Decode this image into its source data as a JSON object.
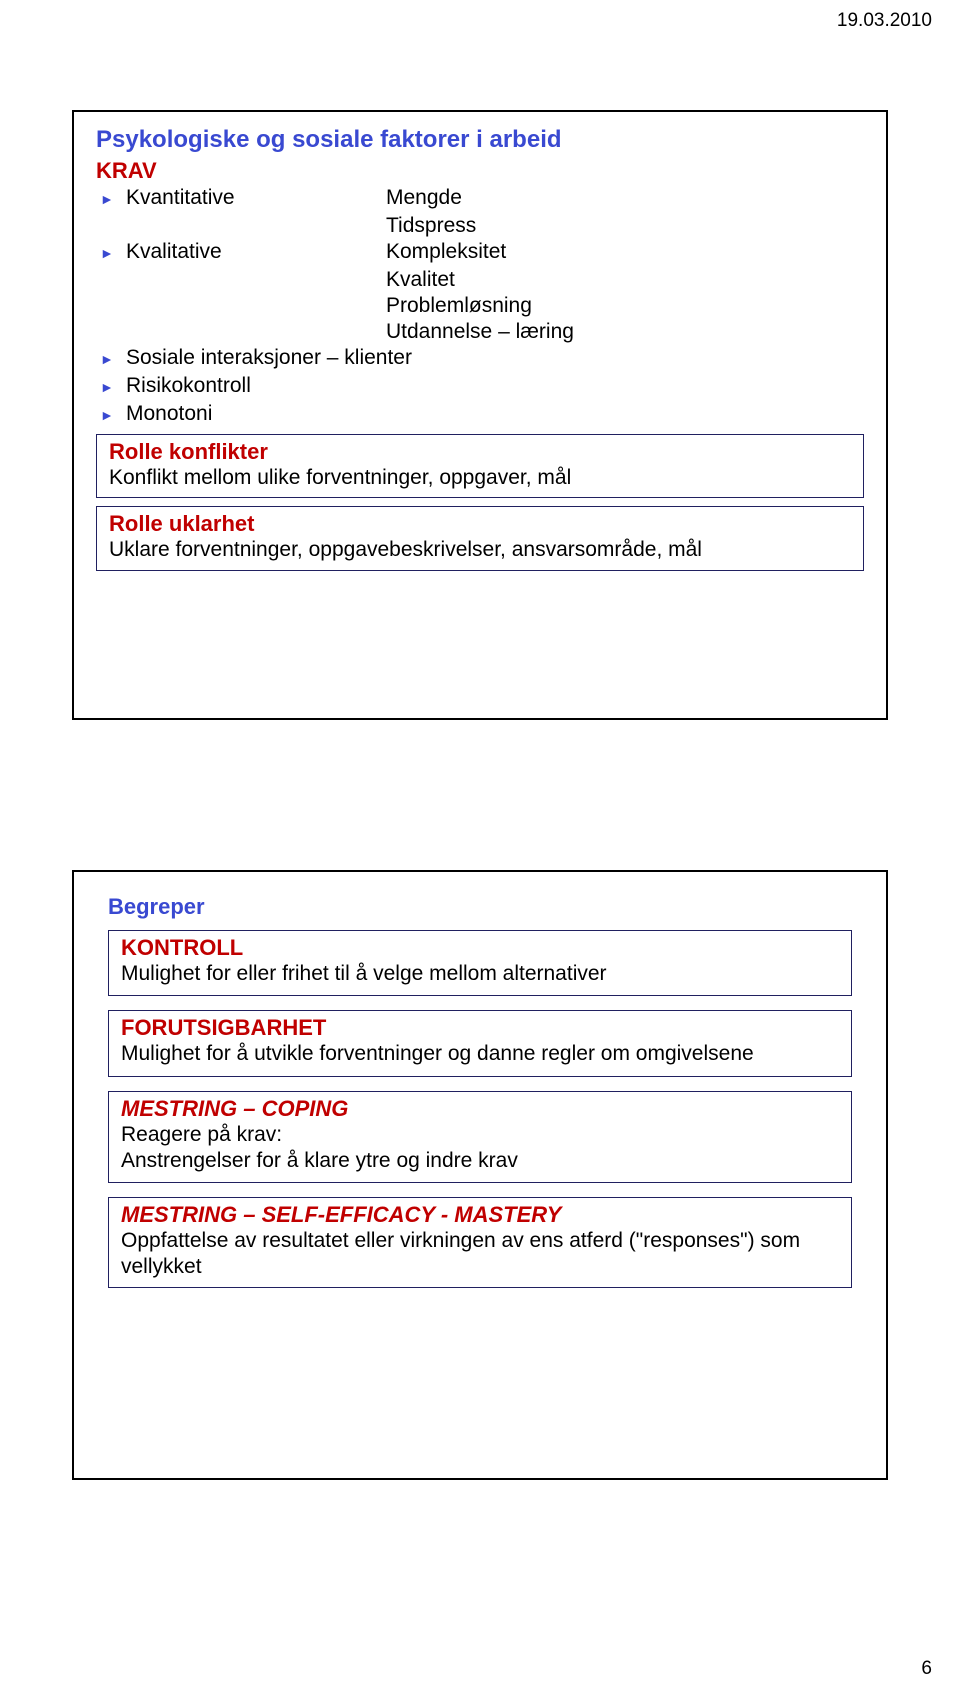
{
  "date": "19.03.2010",
  "page_number": "6",
  "slide1": {
    "title": "Psykologiske og sosiale faktorer i arbeid",
    "krav": {
      "heading": "KRAV",
      "rows": [
        {
          "label": "Kvantitative",
          "values": [
            "Mengde",
            "Tidspress"
          ]
        },
        {
          "label": "Kvalitative",
          "values": [
            "Kompleksitet",
            "Kvalitet",
            "Problemløsning",
            "Utdannelse – læring"
          ]
        },
        {
          "label": "Sosiale interaksjoner – klienter",
          "values": []
        },
        {
          "label": "Risikokontroll",
          "values": []
        },
        {
          "label": "Monotoni",
          "values": []
        }
      ]
    },
    "box_a": {
      "title": "Rolle konflikter",
      "text": "Konflikt mellom ulike forventninger, oppgaver, mål"
    },
    "box_b": {
      "title": "Rolle uklarhet",
      "text": "Uklare forventninger, oppgavebeskrivelser, ansvarsområde, mål"
    }
  },
  "slide2": {
    "title": "Begreper",
    "boxes": [
      {
        "title": "KONTROLL",
        "lines": [
          "Mulighet for eller frihet til å velge mellom alternativer"
        ]
      },
      {
        "title": "FORUTSIGBARHET",
        "lines": [
          "Mulighet for å utvikle forventninger og danne regler om omgivelsene"
        ]
      },
      {
        "title": "MESTRING – COPING",
        "lines": [
          "Reagere på krav:",
          "Anstrengelser for å klare ytre og indre krav"
        ]
      },
      {
        "title": "MESTRING – SELF-EFFICACY - MASTERY",
        "lines": [
          "Oppfattelse av resultatet eller virkningen av ens atferd (\"responses\") som vellykket"
        ]
      }
    ]
  }
}
